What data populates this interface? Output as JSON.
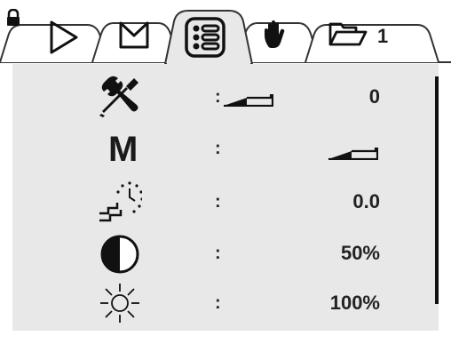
{
  "tabs": {
    "folder_count": "1",
    "icons": [
      "lock-icon",
      "play-icon",
      "m-icon",
      "list-icon",
      "hand-icon",
      "folder-icon"
    ],
    "active": "list"
  },
  "rows": {
    "tools": {
      "icon": "tools-icon",
      "colon": ":",
      "value": "0"
    },
    "mode": {
      "letter": "M",
      "colon": ":",
      "value": ""
    },
    "delay": {
      "icon": "stair-clock-icon",
      "colon": ":",
      "value": "0.0"
    },
    "contrast": {
      "icon": "contrast-icon",
      "colon": ":",
      "value": "50%"
    },
    "brightness": {
      "icon": "sun-icon",
      "colon": ":",
      "value": "100%"
    }
  },
  "colors": {
    "panel": "#e8e8e8",
    "ink": "#1a1a1a",
    "tab_border": "#333333"
  }
}
